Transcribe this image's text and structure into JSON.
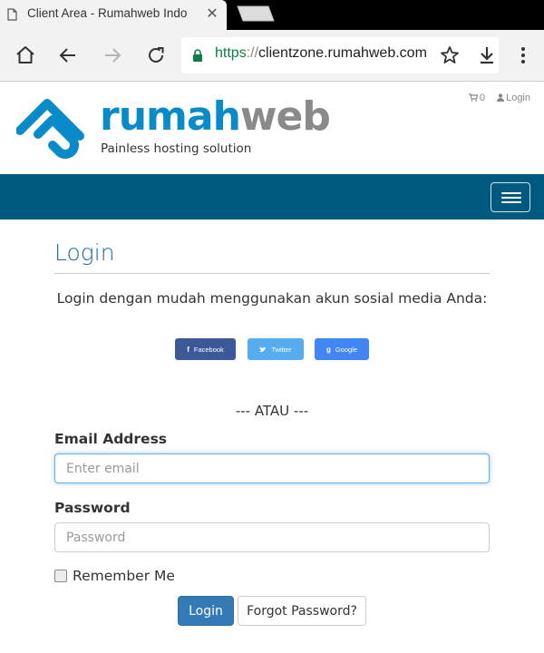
{
  "browser": {
    "tab_title": "Client Area - Rumahweb Indo",
    "url_scheme": "https",
    "url_separator": "://",
    "url_host": "clientzone.rumahweb.com",
    "icons": [
      "page-icon",
      "close-icon",
      "home-icon",
      "back-icon",
      "forward-icon",
      "reload-icon",
      "lock-icon",
      "star-icon",
      "download-icon",
      "menu-icon"
    ]
  },
  "header": {
    "logo_part1": "rumah",
    "logo_part2": "web",
    "tagline": "Painless hosting solution",
    "cart_count": "0",
    "login_link": "Login",
    "brand_blue": "#0a8bc9",
    "brand_gray": "#8a8a8a",
    "nav_color": "#005a80"
  },
  "main": {
    "title": "Login",
    "social_intro": "Login dengan mudah menggunakan akun sosial media Anda:",
    "social_buttons": [
      {
        "label": "Facebook",
        "icon": "f",
        "color": "#3b5998"
      },
      {
        "label": "Twitter",
        "icon": "twitter-bird",
        "color": "#55acee"
      },
      {
        "label": "Google",
        "icon": "g",
        "color": "#4285f4"
      }
    ],
    "divider": "--- ATAU ---",
    "email_label": "Email Address",
    "email_placeholder": "Enter email",
    "password_label": "Password",
    "password_placeholder": "Password",
    "remember_label": "Remember Me",
    "login_button": "Login",
    "forgot_button": "Forgot Password?"
  }
}
